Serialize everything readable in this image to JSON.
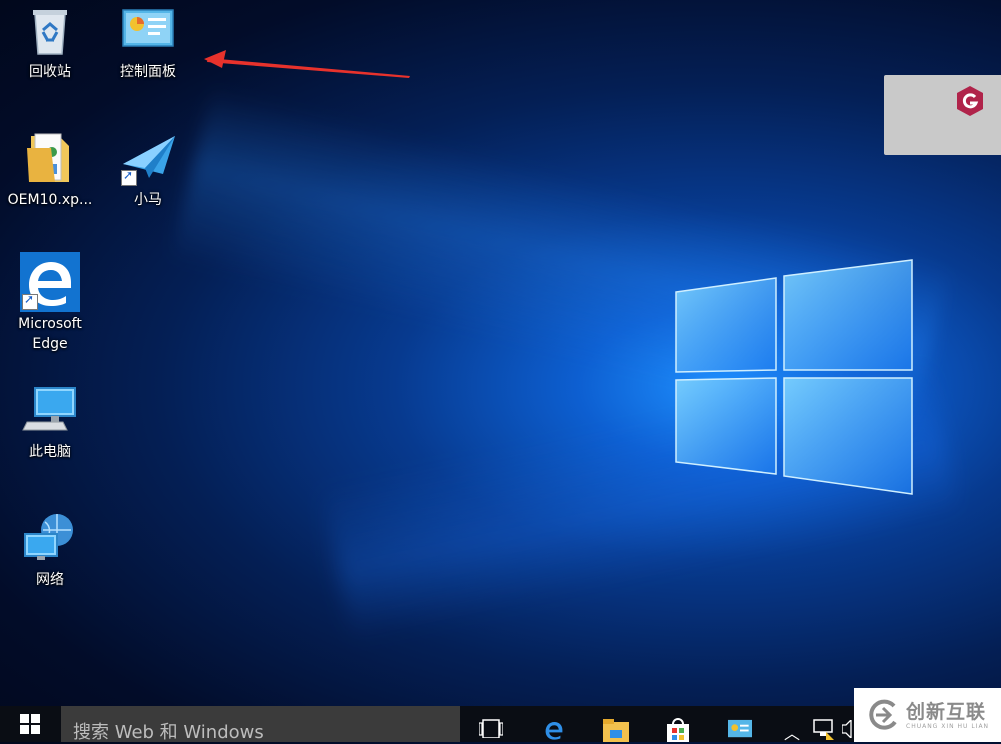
{
  "desktop": {
    "icons": [
      {
        "label": "回收站",
        "icon": "recycle-bin-icon"
      },
      {
        "label": "控制面板",
        "icon": "control-panel-icon"
      },
      {
        "label": "OEM10.xp...",
        "icon": "folder-icon"
      },
      {
        "label": "小马",
        "icon": "paper-plane-icon"
      },
      {
        "label": "Microsoft\nEdge",
        "icon": "edge-icon"
      },
      {
        "label": "此电脑",
        "icon": "computer-icon"
      },
      {
        "label": "网络",
        "icon": "network-icon"
      }
    ],
    "annotation": "red-arrow-pointing-to-control-panel"
  },
  "taskbar": {
    "search_placeholder": "搜索 Web 和 Windows",
    "pinned": [
      "task-view-icon",
      "edge-icon",
      "file-explorer-icon",
      "store-icon",
      "control-panel-icon"
    ],
    "tray": [
      "chevron-up-icon",
      "network-icon",
      "volume-icon"
    ]
  },
  "watermark": {
    "text_cn": "创新互联",
    "text_en": "CHUANG XIN HU LIAN"
  },
  "colors": {
    "desktop_dark": "#020c29",
    "desktop_blue": "#0d5fd1",
    "taskbar": "#0a0d14",
    "search_box": "#3b3b3b",
    "arrow": "#e8322c"
  }
}
